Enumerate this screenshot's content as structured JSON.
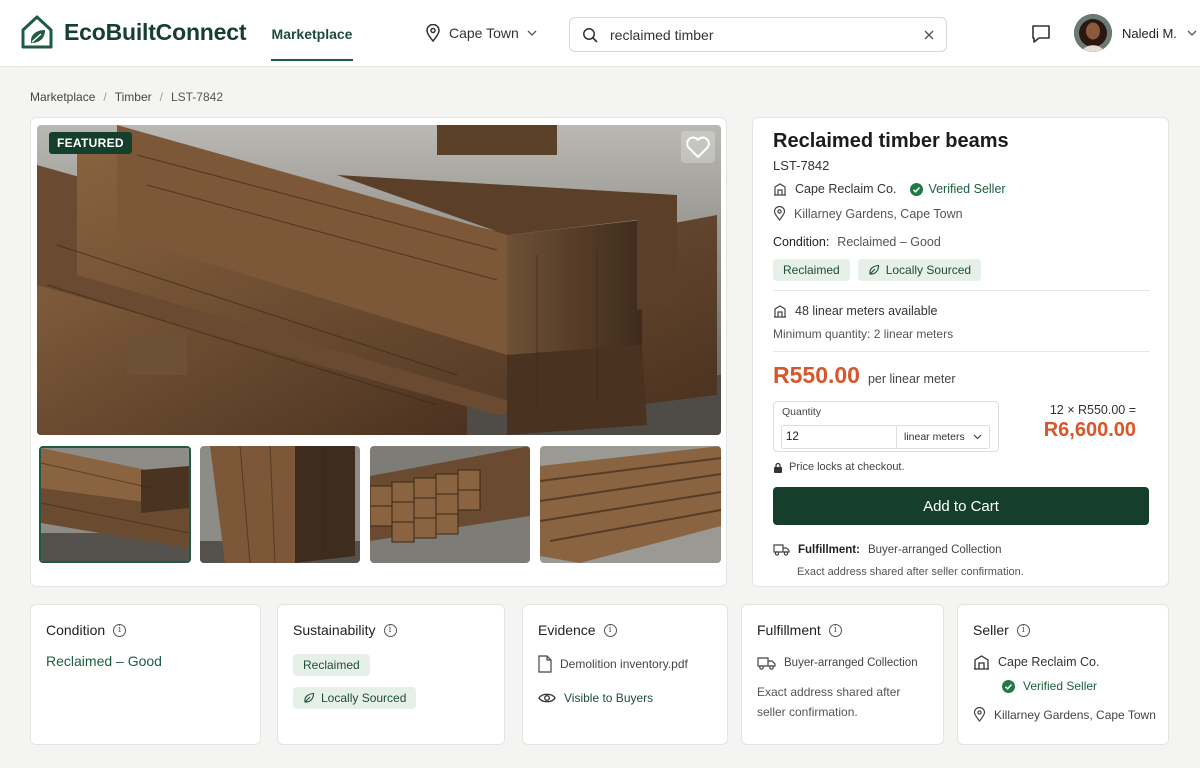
{
  "app": {
    "name": "EcoBuiltConnect",
    "nav_marketplace": "Marketplace",
    "location": "Cape Town",
    "search_value": "reclaimed timber",
    "user_name": "Naledi M."
  },
  "breadcrumb": {
    "items": [
      "Marketplace",
      "Timber",
      "LST-7842"
    ]
  },
  "gallery": {
    "badge": "FEATURED"
  },
  "listing": {
    "title": "Reclaimed timber beams",
    "id": "LST-7842",
    "seller": "Cape Reclaim Co.",
    "verified": "Verified Seller",
    "location": "Killarney Gardens, Cape Town",
    "condition_label": "Condition:",
    "condition_value": "Reclaimed – Good",
    "tags": [
      "Reclaimed",
      "Locally Sourced"
    ],
    "availability": "48 linear meters available",
    "minimum": "Minimum quantity: 2 linear meters",
    "price": "R550.00",
    "price_unit": "per linear meter",
    "quantity_label": "Quantity",
    "quantity_value": "12",
    "unit_option": "linear meters",
    "formula": "12 × R550.00 =",
    "total": "R6,600.00",
    "lock_note": "Price locks at checkout.",
    "cart_button": "Add to Cart",
    "fulfillment_label": "Fulfillment:",
    "fulfillment_value": "Buyer-arranged Collection",
    "fulfillment_note": "Exact address shared after seller confirmation."
  },
  "cards": {
    "condition": {
      "title": "Condition",
      "value": "Reclaimed – Good"
    },
    "sustainability": {
      "title": "Sustainability",
      "tag1": "Reclaimed",
      "tag2": "Locally Sourced"
    },
    "evidence": {
      "title": "Evidence",
      "file": "Demolition inventory.pdf",
      "visibility": "Visible to Buyers"
    },
    "fulfillment": {
      "title": "Fulfillment",
      "method": "Buyer-arranged Collection",
      "note_line1": "Exact address shared after",
      "note_line2": "seller confirmation."
    },
    "seller": {
      "title": "Seller",
      "name": "Cape Reclaim Co.",
      "verified": "Verified Seller",
      "location": "Killarney Gardens, Cape Town"
    }
  },
  "colors": {
    "brand": "#153f2c",
    "accent": "#d9562b",
    "tag_bg": "#e6efe8"
  }
}
